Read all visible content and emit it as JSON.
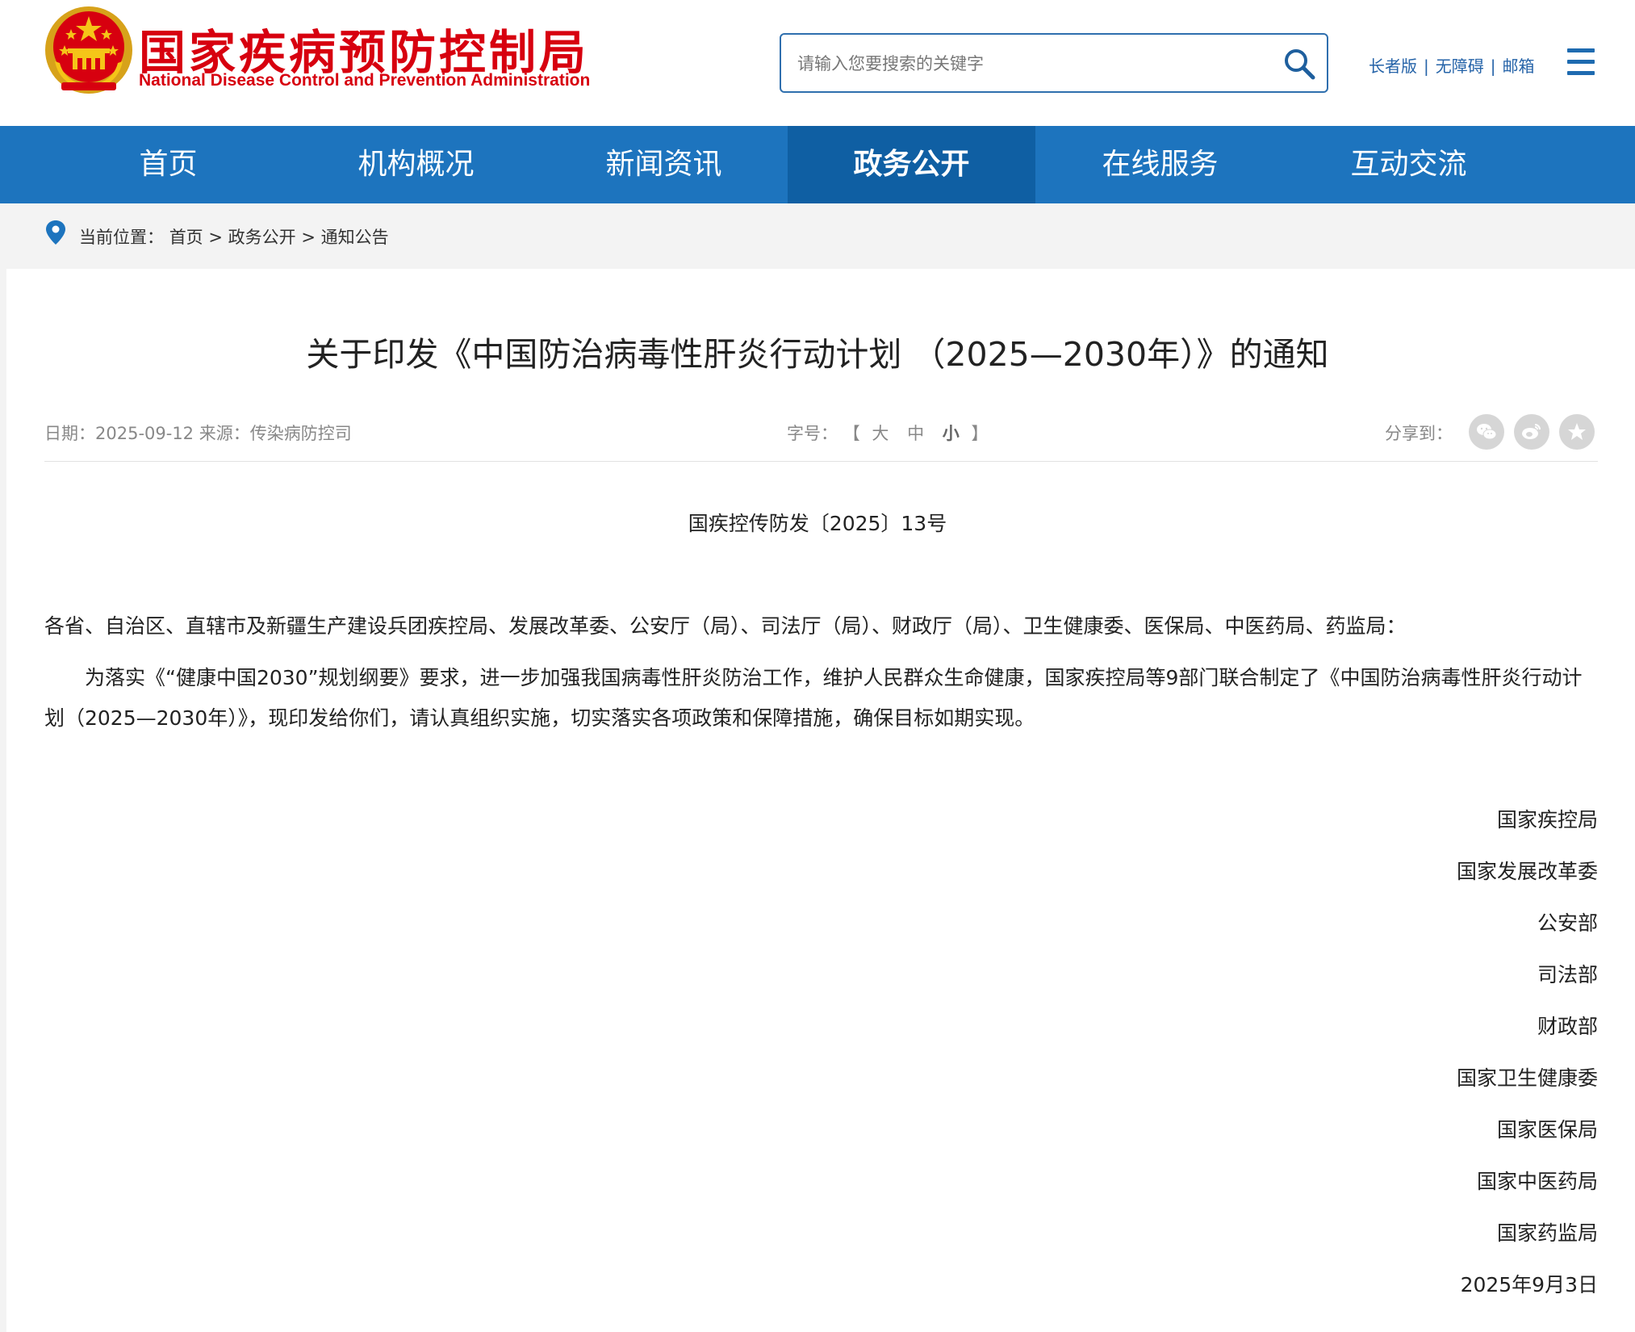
{
  "header": {
    "title_cn": "国家疾病预防控制局",
    "title_en": "National Disease Control and Prevention Administration",
    "emblem": "national-emblem",
    "search": {
      "placeholder": "请输入您要搜索的关键字",
      "icon": "search-icon"
    },
    "links": [
      "长者版",
      "无障碍",
      "邮箱"
    ],
    "menu_icon": "hamburger-menu-icon"
  },
  "nav": {
    "items": [
      "首页",
      "机构概况",
      "新闻资讯",
      "政务公开",
      "在线服务",
      "互动交流"
    ],
    "active": "政务公开"
  },
  "breadcrumb": {
    "label": "当前位置：",
    "items": [
      "首页",
      "政务公开",
      "通知公告"
    ],
    "separator": ">"
  },
  "article": {
    "title": "关于印发《中国防治病毒性肝炎行动计划 （2025—2030年）》的通知",
    "meta": {
      "date_label": "日期：",
      "date": "2025-09-12",
      "source_label": "来源：",
      "source": "传染病防控司",
      "font_size_label": "字号：",
      "bracket_open": "【",
      "bracket_close": "】",
      "font_sizes": [
        "大",
        "中",
        "小"
      ],
      "font_size_selected": "小",
      "share_label": "分享到：",
      "share_icons": [
        "wechat-icon",
        "weibo-icon",
        "favorite-star-icon"
      ]
    },
    "doc_number": "国疾控传防发〔2025〕13号",
    "addressee": "各省、自治区、直辖市及新疆生产建设兵团疾控局、发展改革委、公安厅（局）、司法厅（局）、财政厅（局）、卫生健康委、医保局、中医药局、药监局：",
    "paragraph": "为落实《“健康中国2030”规划纲要》要求，进一步加强我国病毒性肝炎防治工作，维护人民群众生命健康，国家疾控局等9部门联合制定了《中国防治病毒性肝炎行动计划（2025—2030年）》，现印发给你们，请认真组织实施，切实落实各项政策和保障措施，确保目标如期实现。",
    "signatories": [
      "国家疾控局",
      "国家发展改革委",
      "公安部",
      "司法部",
      "财政部",
      "国家卫生健康委",
      "国家医保局",
      "国家中医药局",
      "国家药监局"
    ],
    "sign_date": "2025年9月3日"
  },
  "colors": {
    "brand_red": "#d7000f",
    "nav_blue": "#1d74be",
    "nav_active": "#0f5fa3",
    "link_blue": "#2563a8"
  }
}
